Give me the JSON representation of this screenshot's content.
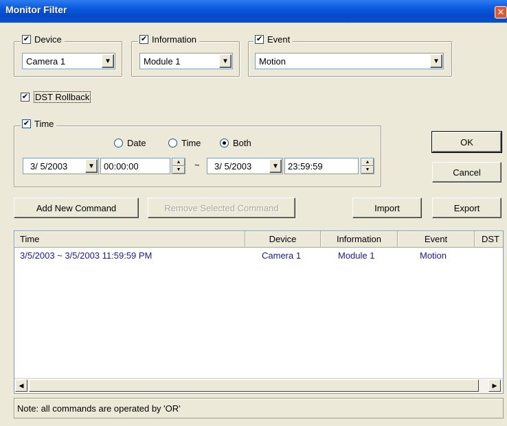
{
  "window": {
    "title": "Monitor Filter",
    "close_glyph": "✕"
  },
  "device": {
    "label": "Device",
    "checked": true,
    "value": "Camera 1"
  },
  "information": {
    "label": "Information",
    "checked": true,
    "value": "Module 1"
  },
  "event": {
    "label": "Event",
    "checked": true,
    "value": "Motion"
  },
  "dst": {
    "label": "DST Rollback",
    "checked": true
  },
  "time": {
    "label": "Time",
    "checked": true,
    "radios": [
      {
        "label": "Date",
        "selected": false
      },
      {
        "label": "Time",
        "selected": false
      },
      {
        "label": "Both",
        "selected": true
      }
    ],
    "start_date": "3/ 5/2003",
    "start_time": "00:00:00",
    "separator": "~",
    "end_date": "3/ 5/2003",
    "end_time": "23:59:59"
  },
  "buttons": {
    "ok": "OK",
    "cancel": "Cancel",
    "add": "Add New Command",
    "remove": "Remove Selected Command",
    "import": "Import",
    "export": "Export"
  },
  "list": {
    "columns": [
      "Time",
      "Device",
      "Information",
      "Event",
      "DST"
    ],
    "rows": [
      {
        "time": "3/5/2003 ~ 3/5/2003 11:59:59 PM",
        "device": "Camera 1",
        "information": "Module 1",
        "event": "Motion"
      }
    ]
  },
  "note": "Note: all commands are operated by 'OR'",
  "icons": {
    "check": "✔",
    "dropdown": "▼",
    "spin_up": "▲",
    "spin_down": "▼",
    "scroll_left": "◀",
    "scroll_right": "▶"
  },
  "colors": {
    "titlebar": "#0a5be0",
    "list_text": "#1a1a9c",
    "dialog_bg": "#ece9d8"
  }
}
